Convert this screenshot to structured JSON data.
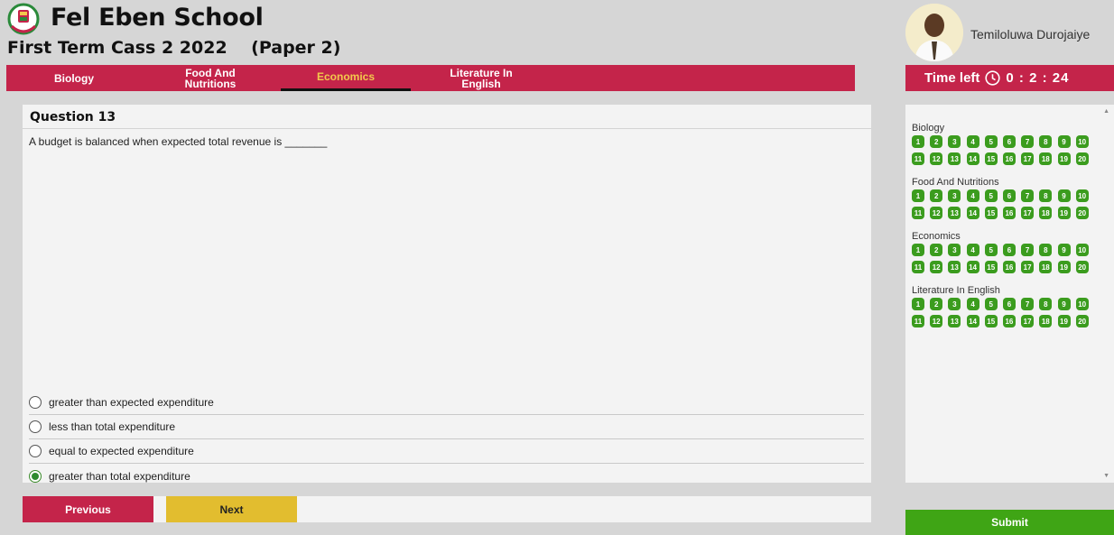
{
  "header": {
    "school_name": "Fel Eben School",
    "exam_title": "First Term Cass 2 2022    (Paper 2)"
  },
  "user": {
    "name": "Temiloluwa Durojaiye"
  },
  "timer": {
    "label": "Time left",
    "value": "0 : 2 : 24"
  },
  "tabs": [
    {
      "label": "Biology",
      "active": false
    },
    {
      "label": "Food And Nutritions",
      "active": false
    },
    {
      "label": "Economics",
      "active": true
    },
    {
      "label": "Literature In English",
      "active": false
    }
  ],
  "question": {
    "title": "Question 13",
    "text": "A budget is balanced when expected total revenue is _______",
    "options": [
      {
        "label": "greater than expected expenditure",
        "selected": false
      },
      {
        "label": "less than total expenditure",
        "selected": false
      },
      {
        "label": "equal to expected expenditure",
        "selected": false
      },
      {
        "label": "greater than total expenditure",
        "selected": true
      }
    ]
  },
  "navigation": {
    "previous_label": "Previous",
    "next_label": "Next"
  },
  "question_map": {
    "sections": [
      {
        "title": "Biology",
        "numbers": [
          "1",
          "2",
          "3",
          "4",
          "5",
          "6",
          "7",
          "8",
          "9",
          "10",
          "11",
          "12",
          "13",
          "14",
          "15",
          "16",
          "17",
          "18",
          "19",
          "20"
        ]
      },
      {
        "title": "Food And Nutritions",
        "numbers": [
          "1",
          "2",
          "3",
          "4",
          "5",
          "6",
          "7",
          "8",
          "9",
          "10",
          "11",
          "12",
          "13",
          "14",
          "15",
          "16",
          "17",
          "18",
          "19",
          "20"
        ]
      },
      {
        "title": "Economics",
        "numbers": [
          "1",
          "2",
          "3",
          "4",
          "5",
          "6",
          "7",
          "8",
          "9",
          "10",
          "11",
          "12",
          "13",
          "14",
          "15",
          "16",
          "17",
          "18",
          "19",
          "20"
        ]
      },
      {
        "title": "Literature In English",
        "numbers": [
          "1",
          "2",
          "3",
          "4",
          "5",
          "6",
          "7",
          "8",
          "9",
          "10",
          "11",
          "12",
          "13",
          "14",
          "15",
          "16",
          "17",
          "18",
          "19",
          "20"
        ]
      }
    ]
  },
  "submit_label": "Submit",
  "colors": {
    "brand_red": "#c4244a",
    "active_tab": "#f2c94c",
    "answered_green": "#3b9c1e",
    "submit_green": "#3fa515",
    "next_yellow": "#e2bd2f"
  }
}
